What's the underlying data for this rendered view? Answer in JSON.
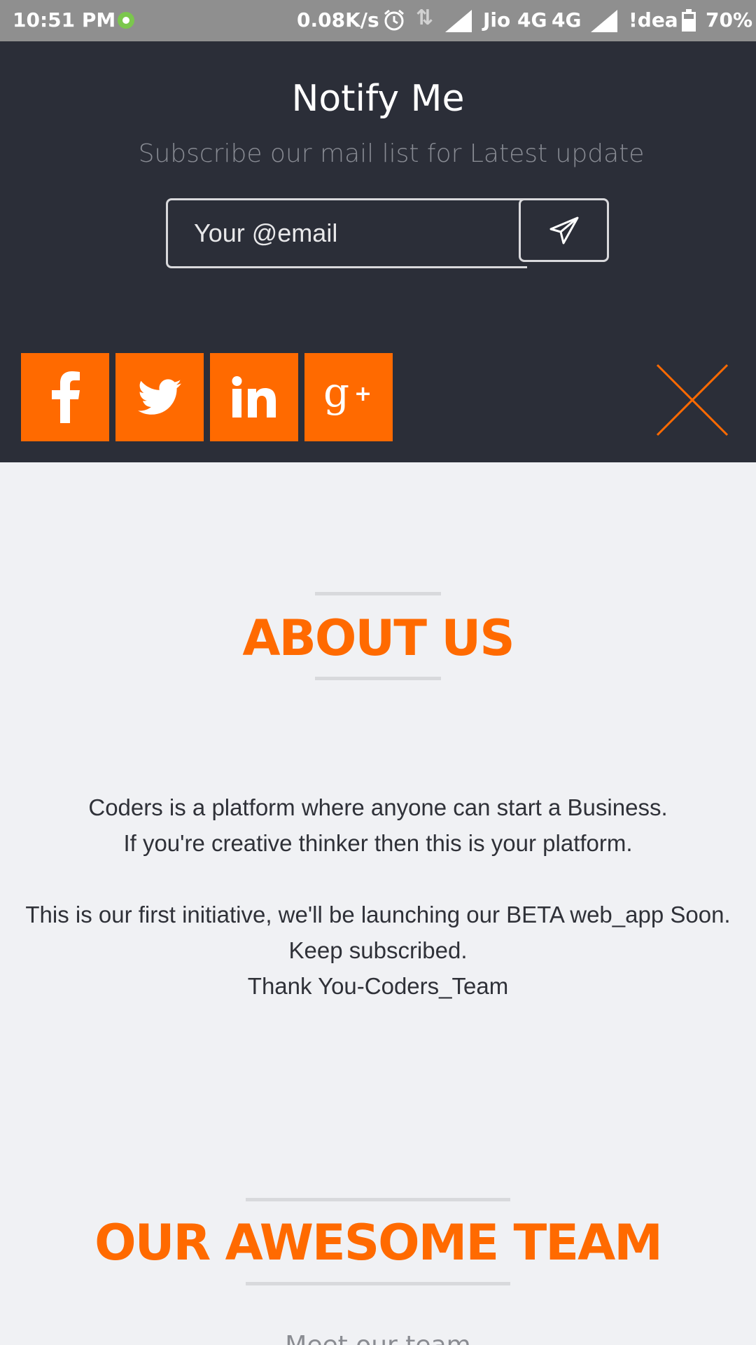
{
  "status_bar": {
    "time": "10:51 PM",
    "net_speed": "0.08K/s",
    "carrier1": "Jio 4G",
    "network2": "4G",
    "carrier2": "!dea",
    "battery_percent": "70%",
    "battery_level": 0.7
  },
  "notify": {
    "title": "Notify Me",
    "subtitle": "Subscribe our mail list for Latest update",
    "email_placeholder": "Your @email",
    "email_value": ""
  },
  "social": {
    "buttons": [
      {
        "name": "facebook",
        "glyph": "f"
      },
      {
        "name": "twitter",
        "glyph": ""
      },
      {
        "name": "linkedin",
        "glyph": "in"
      },
      {
        "name": "google-plus",
        "glyph": "g+"
      }
    ],
    "accent_color": "#ff6a00"
  },
  "about": {
    "heading": "ABOUT US",
    "lines": [
      "Coders is a platform where anyone can start a Business.",
      "If you're creative thinker then this is your platform.",
      "This is our first initiative, we'll be launching our BETA web_app Soon.",
      "Keep subscribed.",
      "Thank You-Coders_Team"
    ]
  },
  "team": {
    "heading": "OUR AWESOME TEAM",
    "subtitle": "Meet our team"
  },
  "colors": {
    "panel_bg": "#2b2e38",
    "page_bg": "#f0f1f4",
    "accent": "#ff6a00",
    "status_bar": "#8f8f8f"
  }
}
